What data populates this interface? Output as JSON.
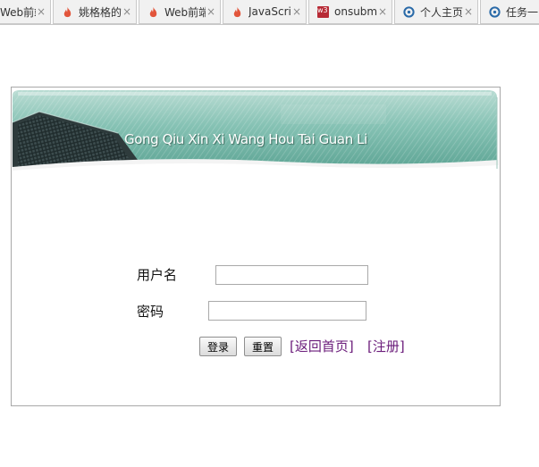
{
  "tabs": [
    {
      "label": "Web前端",
      "icon": "none",
      "close": "×"
    },
    {
      "label": "姚格格的",
      "icon": "flame-icon",
      "close": "×"
    },
    {
      "label": "Web前端",
      "icon": "flame-icon",
      "close": "×"
    },
    {
      "label": "JavaScript",
      "icon": "flame-icon",
      "close": "×"
    },
    {
      "label": "onsubmit",
      "icon": "w3-icon",
      "icon_text": "w3",
      "close": "×"
    },
    {
      "label": "个人主页",
      "icon": "ring-icon",
      "close": "×"
    },
    {
      "label": "任务一",
      "icon": "ring-icon",
      "close": ""
    }
  ],
  "banner": {
    "title": "Gong Qiu Xin Xi Wang Hou Tai Guan Li"
  },
  "form": {
    "username_label": "用户名",
    "username_value": "",
    "password_label": "密码",
    "password_value": "",
    "login_button": "登录",
    "reset_button": "重置",
    "home_link": "[返回首页]",
    "register_link": "[注册]"
  },
  "colors": {
    "link": "#6a1b7a",
    "banner_teal": "#6fb3a4",
    "flame": "#e2553b",
    "ring": "#2a6aa8",
    "w3": "#b72a35"
  }
}
